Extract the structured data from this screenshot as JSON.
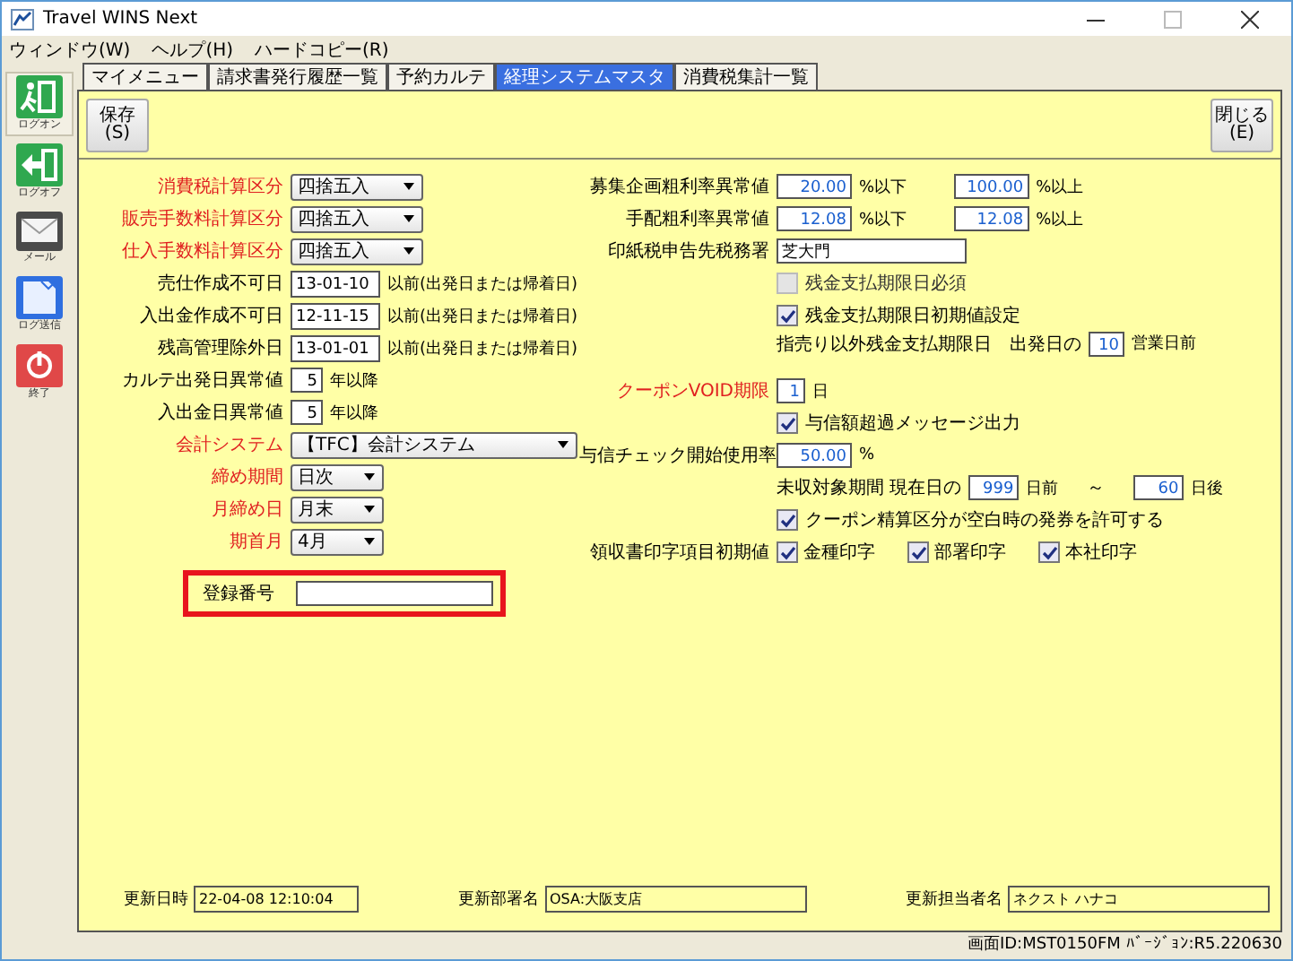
{
  "window": {
    "title": "Travel WINS Next"
  },
  "menu": [
    "ウィンドウ(W)",
    "ヘルプ(H)",
    "ハードコピー(R)"
  ],
  "sidebar": [
    {
      "kind": "logon",
      "label": "ログオン"
    },
    {
      "kind": "logoff",
      "label": "ログオフ"
    },
    {
      "kind": "mail",
      "label": "メール"
    },
    {
      "kind": "send",
      "label": "ログ送信"
    },
    {
      "kind": "exit",
      "label": "終了"
    }
  ],
  "tabs": [
    {
      "label": "マイメニュー",
      "selected": false
    },
    {
      "label": "請求書発行履歴一覧",
      "selected": false
    },
    {
      "label": "予約カルテ",
      "selected": false
    },
    {
      "label": "経理システムマスタ",
      "selected": true
    },
    {
      "label": "消費税集計一覧",
      "selected": false
    }
  ],
  "toolbar": {
    "save": {
      "label": "保存",
      "key": "(S)"
    },
    "close": {
      "label": "閉じる",
      "key": "(E)"
    }
  },
  "left_fields": [
    {
      "kind": "select",
      "label": "消費税計算区分",
      "required": true,
      "value": "四捨五入"
    },
    {
      "kind": "select",
      "label": "販売手数料計算区分",
      "required": true,
      "value": "四捨五入"
    },
    {
      "kind": "select",
      "label": "仕入手数料計算区分",
      "required": true,
      "value": "四捨五入"
    },
    {
      "kind": "date",
      "label": "売仕作成不可日",
      "required": false,
      "value": "13-01-10",
      "suffix": "以前(出発日または帰着日)"
    },
    {
      "kind": "date",
      "label": "入出金作成不可日",
      "required": false,
      "value": "12-11-15",
      "suffix": "以前(出発日または帰着日)"
    },
    {
      "kind": "date",
      "label": "残高管理除外日",
      "required": false,
      "value": "13-01-01",
      "suffix": "以前(出発日または帰着日)"
    },
    {
      "kind": "number",
      "label": "カルテ出発日異常値",
      "required": false,
      "value": "5",
      "suffix": "年以降"
    },
    {
      "kind": "number",
      "label": "入出金日異常値",
      "required": false,
      "value": "5",
      "suffix": "年以降"
    },
    {
      "kind": "select",
      "label": "会計システム",
      "required": true,
      "value": "【TFC】会計システム"
    },
    {
      "kind": "select",
      "label": "締め期間",
      "required": true,
      "value": "日次"
    },
    {
      "kind": "select",
      "label": "月締め日",
      "required": true,
      "value": "月末"
    },
    {
      "kind": "select",
      "label": "期首月",
      "required": true,
      "value": "4月"
    }
  ],
  "registration": {
    "label": "登録番号",
    "highlighted": true
  },
  "right_fields": [
    {
      "kind": "range",
      "label": "募集企画粗利率異常値",
      "low": "20.00",
      "low_suffix": "%以下",
      "high": "100.00",
      "high_suffix": "%以上"
    },
    {
      "kind": "range",
      "label": "手配粗利率異常値",
      "low": "12.08",
      "low_suffix": "%以下",
      "high": "12.08",
      "high_suffix": "%以上"
    },
    {
      "kind": "text",
      "label": "印紙税申告先税務署",
      "value": "芝大門"
    },
    {
      "kind": "checkbox",
      "label": "残金支払期限日必須",
      "checked": false,
      "disabled": true
    },
    {
      "kind": "checkbox",
      "label": "残金支払期限日初期値設定",
      "checked": true,
      "disabled": false
    },
    {
      "kind": "offset",
      "text": "指売り以外残金支払期限日",
      "prefix": "出発日の",
      "value": "10",
      "suffix": "営業日前"
    },
    {
      "kind": "number",
      "label": "クーポンVOID期限",
      "required": true,
      "value": "1",
      "suffix": "日"
    },
    {
      "kind": "checkbox",
      "label": "与信額超過メッセージ出力",
      "checked": true,
      "disabled": false
    },
    {
      "kind": "number",
      "label": "与信チェック開始使用率",
      "required": false,
      "value": "50.00",
      "suffix": "%"
    },
    {
      "kind": "period",
      "text": "未収対象期間 現在日の",
      "value": "999",
      "middle": "日前",
      "separator": "～",
      "value2": "60",
      "suffix": "日後"
    },
    {
      "kind": "checkbox",
      "label": "クーポン精算区分が空白時の発券を許可する",
      "checked": true,
      "disabled": false
    },
    {
      "kind": "checkgroup",
      "label": "領収書印字項目初期値",
      "options": [
        {
          "label": "金種印字",
          "checked": true
        },
        {
          "label": "部署印字",
          "checked": true
        },
        {
          "label": "本社印字",
          "checked": true
        }
      ]
    }
  ],
  "footer": [
    {
      "label": "更新日時",
      "value": "22-04-08 12:10:04"
    },
    {
      "label": "更新部署名",
      "value": "OSA:大阪支店"
    },
    {
      "label": "更新担当者名",
      "value": "ネクスト ハナコ"
    }
  ],
  "status_bar": "画面ID:MST0150FM ﾊﾞｰｼﾞｮﾝ:R5.220630"
}
